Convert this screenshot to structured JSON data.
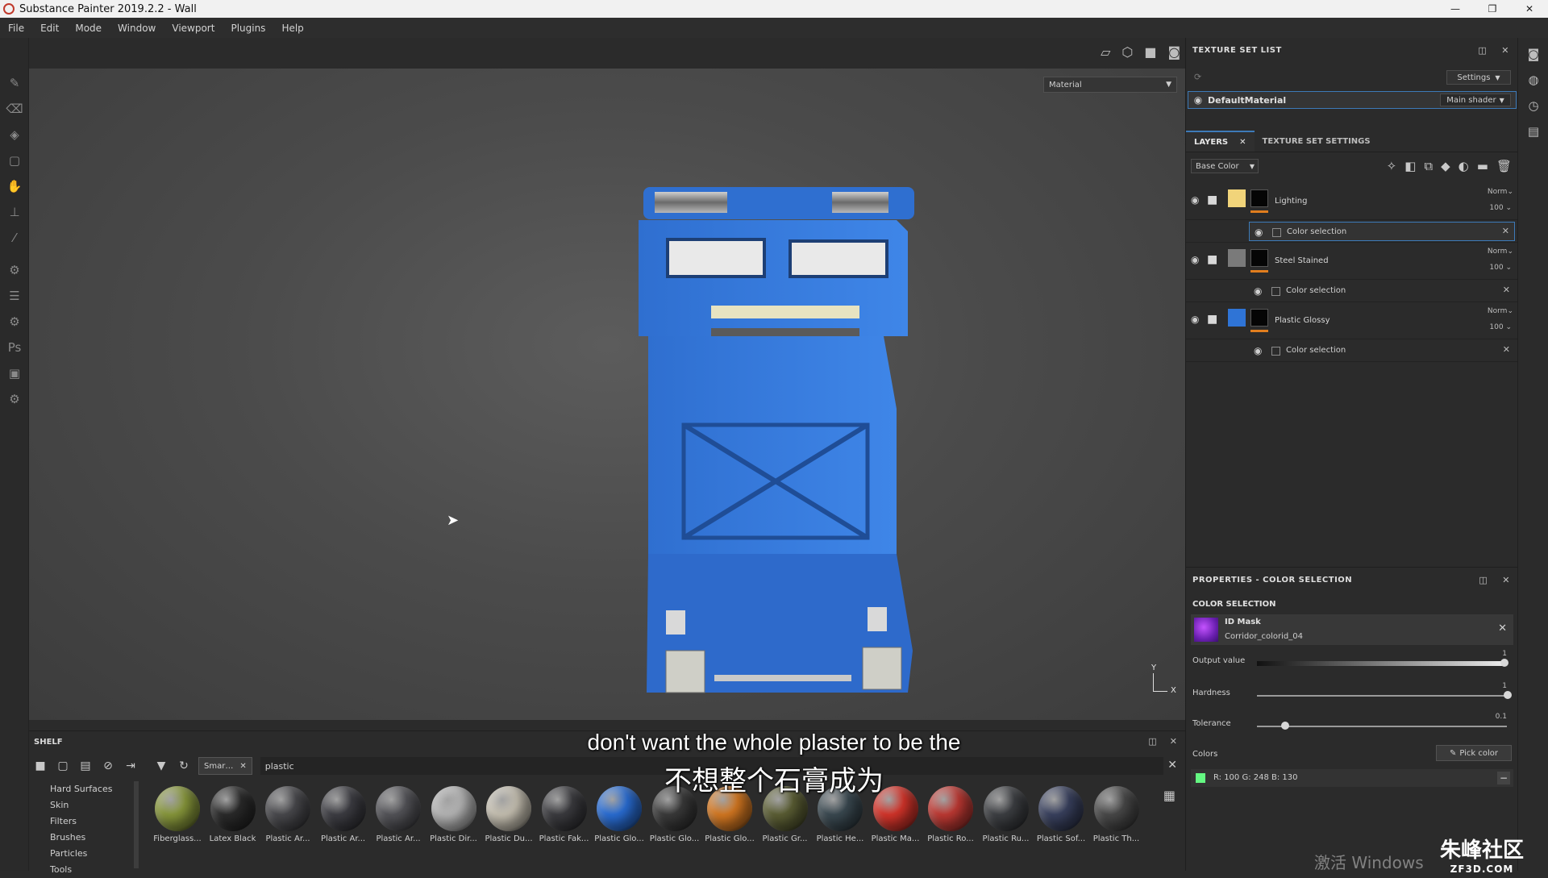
{
  "window": {
    "title": "Substance Painter 2019.2.2 - Wall",
    "controls": [
      "—",
      "❐",
      "✕"
    ]
  },
  "menu": [
    "File",
    "Edit",
    "Mode",
    "Window",
    "Viewport",
    "Plugins",
    "Help"
  ],
  "left_tools": [
    "paint-brush-icon",
    "eraser-icon",
    "projection-icon",
    "geometry-mask-icon",
    "smudge-icon",
    "clone-stamp-icon",
    "color-picker-icon",
    "bake-icon",
    "texture-set-icon",
    "settings-icon",
    "photoshop-export-icon",
    "export-icon",
    "gear-icon"
  ],
  "viewport": {
    "mode_dropdown": "Material",
    "axis_labels": {
      "y": "Y",
      "x": "X"
    }
  },
  "texture_set_list": {
    "title": "TEXTURE SET LIST",
    "settings_label": "Settings",
    "material": "DefaultMaterial",
    "shader": "Main shader"
  },
  "layers": {
    "tabs": [
      "LAYERS",
      "TEXTURE SET SETTINGS"
    ],
    "channel": "Base Color",
    "items": [
      {
        "name": "Lighting",
        "blend": "Norm",
        "opacity": "100",
        "color": "#f1d47a",
        "effect": "Color selection"
      },
      {
        "name": "Steel Stained",
        "blend": "Norm",
        "opacity": "100",
        "color": "#7a7a7a",
        "effect": "Color selection"
      },
      {
        "name": "Plastic Glossy",
        "blend": "Norm",
        "opacity": "100",
        "color": "#2f74d6",
        "effect": "Color selection"
      }
    ]
  },
  "properties": {
    "title": "PROPERTIES - COLOR SELECTION",
    "section": "COLOR SELECTION",
    "id_mask_label": "ID Mask",
    "id_mask_map": "Corridor_colorid_04",
    "output_label": "Output value",
    "output_value": "1",
    "hardness_label": "Hardness",
    "hardness_value": "1",
    "tolerance_label": "Tolerance",
    "tolerance_value": "0.1",
    "colors_label": "Colors",
    "pick_color": "Pick color",
    "color_entry": "R: 100   G: 248   B: 130",
    "color_entry_hex": "#64f882"
  },
  "shelf": {
    "title": "SHELF",
    "tab": "Smar…",
    "search": "plastic",
    "categories": [
      "Hard Surfaces",
      "Skin",
      "Filters",
      "Brushes",
      "Particles",
      "Tools"
    ],
    "materials": [
      {
        "name": "Fiberglass...",
        "color": "#8a9a3c"
      },
      {
        "name": "Latex Black",
        "color": "#2b2b2b"
      },
      {
        "name": "Plastic Ar...",
        "color": "#4a4a4e"
      },
      {
        "name": "Plastic Ar...",
        "color": "#3e3e44"
      },
      {
        "name": "Plastic Ar...",
        "color": "#55555a"
      },
      {
        "name": "Plastic Dir...",
        "color": "#b8b8b8"
      },
      {
        "name": "Plastic Du...",
        "color": "#c9c3b4"
      },
      {
        "name": "Plastic Fak...",
        "color": "#3c3c40"
      },
      {
        "name": "Plastic Glo...",
        "color": "#2a6fd8"
      },
      {
        "name": "Plastic Glo...",
        "color": "#3b3b3b"
      },
      {
        "name": "Plastic Glo...",
        "color": "#d87a22"
      },
      {
        "name": "Plastic Gr...",
        "color": "#5d6035"
      },
      {
        "name": "Plastic He...",
        "color": "#3b4a52"
      },
      {
        "name": "Plastic Ma...",
        "color": "#d8352b"
      },
      {
        "name": "Plastic Ro...",
        "color": "#c23a34"
      },
      {
        "name": "Plastic Ru...",
        "color": "#3e4044"
      },
      {
        "name": "Plastic Sof...",
        "color": "#3a4260"
      },
      {
        "name": "Plastic Th...",
        "color": "#4a4a4a"
      }
    ]
  },
  "subtitles": {
    "en": "don't want the whole plaster to be the",
    "zh": "不想整个石膏成为"
  },
  "watermarks": {
    "windows": "激活 Windows",
    "site_big": "朱峰社区",
    "site_small": "ZF3D.COM"
  }
}
